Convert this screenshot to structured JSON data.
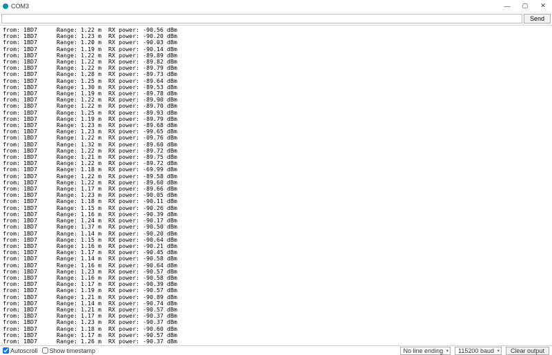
{
  "window": {
    "title": "COM3",
    "min": "—",
    "max": "▢",
    "close": "✕"
  },
  "input": {
    "value": "",
    "placeholder": "",
    "send_label": "Send"
  },
  "log_prefix": {
    "from": "from:",
    "id": "1BD7",
    "range": "Range:",
    "unit_m": "m",
    "rx": "RX power:",
    "unit_dbm": "dBm"
  },
  "rows": [
    {
      "r": "1.22",
      "p": "-90.56"
    },
    {
      "r": "1.23",
      "p": "-90.20"
    },
    {
      "r": "1.20",
      "p": "-90.03"
    },
    {
      "r": "1.19",
      "p": "-90.14"
    },
    {
      "r": "1.22",
      "p": "-89.89"
    },
    {
      "r": "1.22",
      "p": "-89.82"
    },
    {
      "r": "1.22",
      "p": "-89.79"
    },
    {
      "r": "1.28",
      "p": "-89.73"
    },
    {
      "r": "1.25",
      "p": "-89.64"
    },
    {
      "r": "1.30",
      "p": "-89.53"
    },
    {
      "r": "1.19",
      "p": "-89.78"
    },
    {
      "r": "1.22",
      "p": "-89.90"
    },
    {
      "r": "1.22",
      "p": "-89.70"
    },
    {
      "r": "1.25",
      "p": "-89.93"
    },
    {
      "r": "1.19",
      "p": "-89.79"
    },
    {
      "r": "1.23",
      "p": "-89.68"
    },
    {
      "r": "1.23",
      "p": "-99.65"
    },
    {
      "r": "1.22",
      "p": "-09.76"
    },
    {
      "r": "1.32",
      "p": "-89.60"
    },
    {
      "r": "1.22",
      "p": "-89.72"
    },
    {
      "r": "1.21",
      "p": "-89.75"
    },
    {
      "r": "1.22",
      "p": "-89.72"
    },
    {
      "r": "1.18",
      "p": "-69.99"
    },
    {
      "r": "1.22",
      "p": "-89.58"
    },
    {
      "r": "1.22",
      "p": "-89.60"
    },
    {
      "r": "1.17",
      "p": "-89.66"
    },
    {
      "r": "1.23",
      "p": "-90.05"
    },
    {
      "r": "1.18",
      "p": "-90.11"
    },
    {
      "r": "1.15",
      "p": "-90.26"
    },
    {
      "r": "1.16",
      "p": "-90.39"
    },
    {
      "r": "1.24",
      "p": "-90.17"
    },
    {
      "r": "1.37",
      "p": "-90.50"
    },
    {
      "r": "1.14",
      "p": "-90.20"
    },
    {
      "r": "1.15",
      "p": "-90.64"
    },
    {
      "r": "1.16",
      "p": "-90.21"
    },
    {
      "r": "1.17",
      "p": "-90.45"
    },
    {
      "r": "1.14",
      "p": "-90.58"
    },
    {
      "r": "1.16",
      "p": "-90.64"
    },
    {
      "r": "1.23",
      "p": "-90.57"
    },
    {
      "r": "1.16",
      "p": "-90.58"
    },
    {
      "r": "1.17",
      "p": "-90.39"
    },
    {
      "r": "1.19",
      "p": "-90.57"
    },
    {
      "r": "1.21",
      "p": "-90.89"
    },
    {
      "r": "1.14",
      "p": "-90.74"
    },
    {
      "r": "1.21",
      "p": "-90.57"
    },
    {
      "r": "1.17",
      "p": "-90.37"
    },
    {
      "r": "1.23",
      "p": "-90.37"
    },
    {
      "r": "1.18",
      "p": "-90.60"
    },
    {
      "r": "1.17",
      "p": "-90.57"
    },
    {
      "r": "1.26",
      "p": "-90.37"
    }
  ],
  "footer": {
    "autoscroll_label": "Autoscroll",
    "autoscroll_checked": true,
    "timestamp_label": "Show timestamp",
    "timestamp_checked": false,
    "line_ending": "No line ending",
    "baud": "115200 baud",
    "clear_label": "Clear output"
  }
}
